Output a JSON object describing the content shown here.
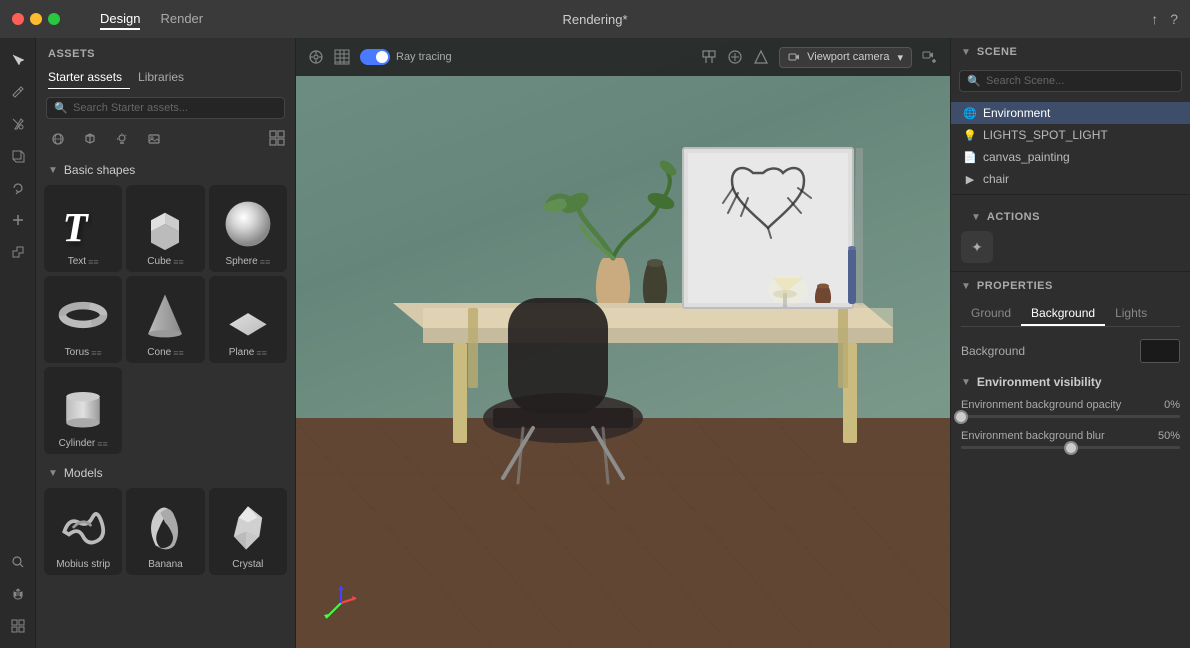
{
  "titlebar": {
    "traffic": [
      "close",
      "minimize",
      "maximize"
    ],
    "nav_items": [
      {
        "label": "Design",
        "active": true
      },
      {
        "label": "Render",
        "active": false
      }
    ],
    "title": "Rendering*",
    "share_icon": "↑",
    "help_icon": "?"
  },
  "assets": {
    "header": "ASSETS",
    "tabs": [
      {
        "label": "Starter assets",
        "active": true
      },
      {
        "label": "Libraries",
        "active": false
      }
    ],
    "search_placeholder": "Search Starter assets...",
    "filter_icons": [
      "sphere-icon",
      "cube-icon",
      "light-icon",
      "image-icon"
    ],
    "sections": {
      "basic_shapes": {
        "title": "Basic shapes",
        "shapes": [
          {
            "label": "Text",
            "has_options": true
          },
          {
            "label": "Cube",
            "has_options": true
          },
          {
            "label": "Sphere",
            "has_options": true
          },
          {
            "label": "Torus",
            "has_options": true
          },
          {
            "label": "Cone",
            "has_options": true
          },
          {
            "label": "Plane",
            "has_options": true
          },
          {
            "label": "Cylinder",
            "has_options": true
          }
        ]
      },
      "models": {
        "title": "Models",
        "shapes": [
          {
            "label": "Mobius strip",
            "has_options": false
          },
          {
            "label": "Banana",
            "has_options": false
          },
          {
            "label": "Crystal",
            "has_options": false
          }
        ]
      }
    }
  },
  "viewport": {
    "ray_tracing_label": "Ray tracing",
    "ray_tracing_enabled": true,
    "camera_label": "Viewport camera",
    "camera_dropdown_arrow": "▾"
  },
  "scene": {
    "header": "SCENE",
    "search_placeholder": "Search Scene...",
    "items": [
      {
        "label": "Environment",
        "icon": "🌐",
        "active": true,
        "indent": false
      },
      {
        "label": "LIGHTS_SPOT_LIGHT",
        "icon": "💡",
        "active": false,
        "indent": false
      },
      {
        "label": "canvas_painting",
        "icon": "📄",
        "active": false,
        "indent": false
      },
      {
        "label": "chair",
        "icon": "▶",
        "active": false,
        "indent": false,
        "has_children": true
      }
    ]
  },
  "actions": {
    "header": "ACTIONS",
    "action_icon": "✦"
  },
  "properties": {
    "header": "PROPERTIES",
    "tabs": [
      {
        "label": "Ground",
        "active": false
      },
      {
        "label": "Background",
        "active": true
      },
      {
        "label": "Lights",
        "active": false
      }
    ],
    "background_label": "Background",
    "background_color": "#1a1a1a",
    "env_visibility": {
      "title": "Environment visibility",
      "opacity_label": "Environment background opacity",
      "opacity_value": "0%",
      "opacity_pct": 0,
      "blur_label": "Environment background blur",
      "blur_value": "50%",
      "blur_pct": 50
    }
  },
  "left_sidebar": {
    "icons": [
      {
        "name": "cursor-icon",
        "symbol": "▶",
        "active": true
      },
      {
        "name": "brush-icon",
        "symbol": "✏",
        "active": false
      },
      {
        "name": "paint-icon",
        "symbol": "🖌",
        "active": false
      },
      {
        "name": "move-icon",
        "symbol": "✥",
        "active": false
      },
      {
        "name": "rotate-icon",
        "symbol": "↻",
        "active": false
      },
      {
        "name": "add-icon",
        "symbol": "+",
        "active": false
      },
      {
        "name": "scale-icon",
        "symbol": "⤢",
        "active": false
      },
      {
        "name": "search-icon",
        "symbol": "🔍",
        "active": false
      },
      {
        "name": "pan-icon",
        "symbol": "✋",
        "active": false
      }
    ],
    "bottom_icons": [
      {
        "name": "settings-icon",
        "symbol": "▦",
        "active": false
      }
    ]
  }
}
